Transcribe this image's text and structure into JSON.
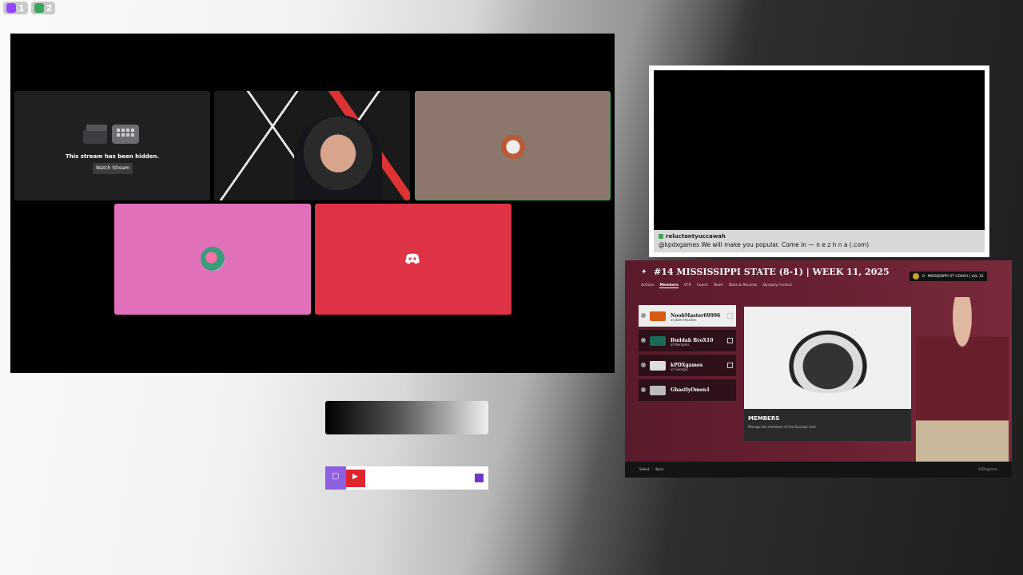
{
  "top_badges": [
    {
      "label": "1",
      "color": "#9146ff",
      "icon": "twitch-icon"
    },
    {
      "label": "2",
      "color": "#3ba55c",
      "icon": "discord-icon"
    }
  ],
  "call": {
    "hidden_message": "This stream has been hidden.",
    "watch_stream_label": "Watch Stream"
  },
  "video": {
    "chat_user": "reluctantyuccawah",
    "chat_message": "@kpdxgames We will make you popular. Come in — n e z h n a (.com)"
  },
  "game": {
    "title": "#14 MISSISSIPPI STATE (8-1) | WEEK 11, 2025",
    "coach_badge": "MISSISSIPPI ST COACH | LVL 12",
    "coach_score": "0",
    "tabs": [
      "Actions",
      "Members",
      "CFR",
      "Coach",
      "Team",
      "Stats & Records",
      "Dynasty Central"
    ],
    "active_tab": "Members",
    "members": [
      {
        "name": "NoobMaster69996",
        "sub": "vs Sam Houston"
      },
      {
        "name": "Buddah BroX10",
        "sub": "at Memphis"
      },
      {
        "name": "kPDXgames",
        "sub": "vs Georgia"
      },
      {
        "name": "GhastlyOmen1",
        "sub": ""
      }
    ],
    "card_title": "MEMBERS",
    "card_desc": "Manage the members of the Dynasty here",
    "foot_select": "Select",
    "foot_back": "Back",
    "foot_user": "kPDXgames"
  }
}
